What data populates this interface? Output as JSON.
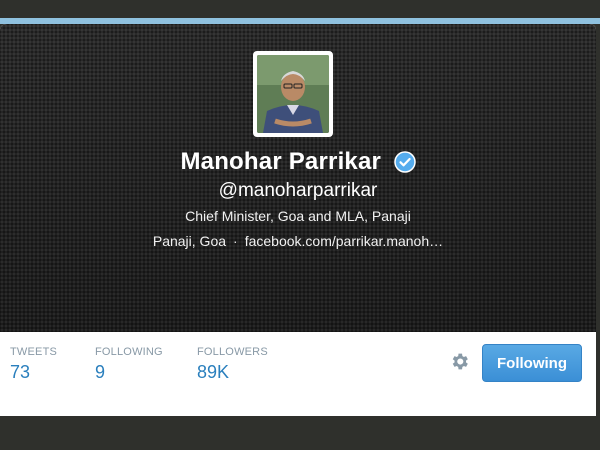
{
  "profile": {
    "name": "Manohar Parrikar",
    "handle": "@manoharparrikar",
    "bio": "Chief Minister, Goa and MLA, Panaji",
    "location": "Panaji, Goa",
    "separator": "·",
    "website": "facebook.com/parrikar.manoh…",
    "verified": true
  },
  "stats": {
    "tweets_label": "TWEETS",
    "tweets_value": "73",
    "following_label": "FOLLOWING",
    "following_value": "9",
    "followers_label": "FOLLOWERS",
    "followers_value": "89K"
  },
  "actions": {
    "follow_label": "Following",
    "settings_icon": "gear-icon"
  },
  "colors": {
    "accent": "#2a7fbd",
    "button": "#4a9de0",
    "verified_badge": "#55acee",
    "header_bg": "#1f1f1f"
  }
}
